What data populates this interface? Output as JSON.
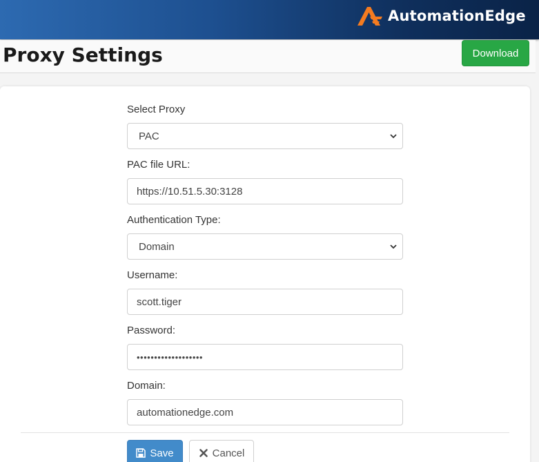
{
  "header": {
    "brand_name": "AutomationEdge",
    "logo_icon": "automationedge-logo-icon",
    "brand_color": "#f47b20"
  },
  "page": {
    "title": "Proxy Settings",
    "download_label": "Download"
  },
  "form": {
    "select_proxy": {
      "label": "Select Proxy",
      "value": "PAC"
    },
    "pac_url": {
      "label": "PAC file URL:",
      "value": "https://10.51.5.30:3128"
    },
    "auth_type": {
      "label": "Authentication Type:",
      "value": "Domain"
    },
    "username": {
      "label": "Username:",
      "value": "scott.tiger"
    },
    "password": {
      "label": "Password:",
      "value": "•••••••••••••••••••"
    },
    "domain": {
      "label": "Domain:",
      "value": "automationedge.com"
    }
  },
  "actions": {
    "save_label": "Save",
    "cancel_label": "Cancel",
    "save_icon": "floppy-disk-icon",
    "cancel_icon": "x-icon"
  },
  "colors": {
    "download_green": "#28a745",
    "save_blue": "#428bca"
  }
}
